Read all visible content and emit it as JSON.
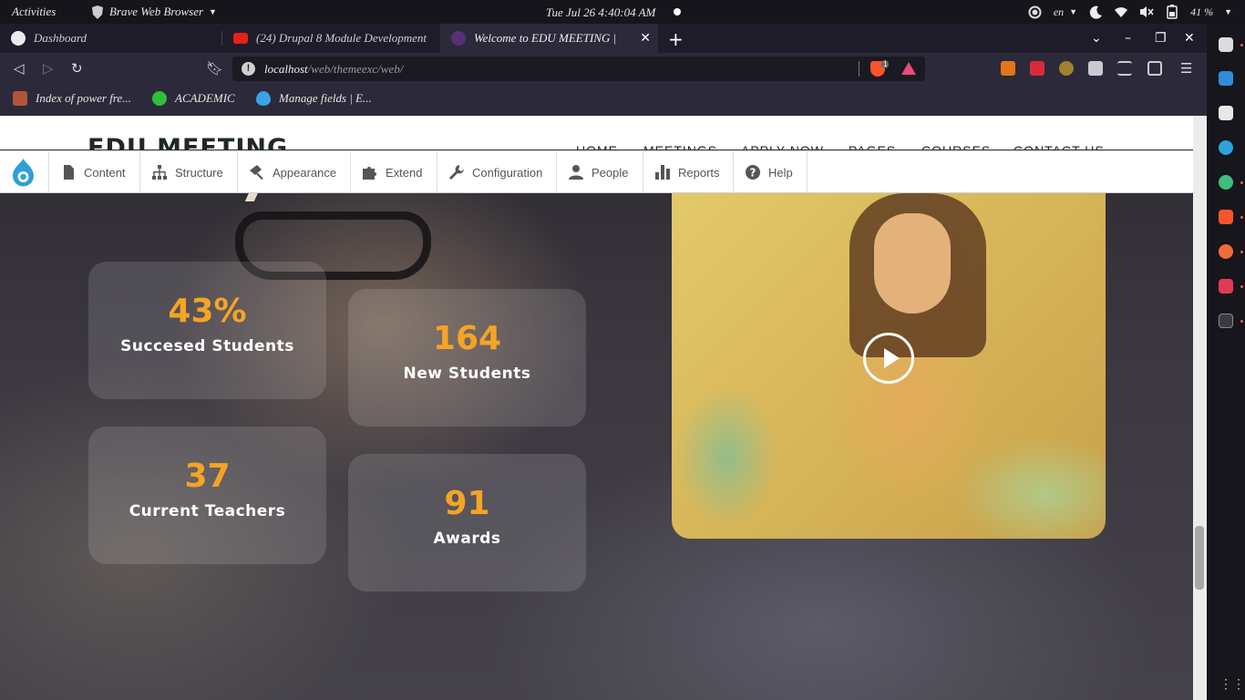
{
  "system_bar": {
    "activities": "Activities",
    "app_name": "Brave Web Browser",
    "clock": "Tue Jul 26  4:40:04 AM",
    "language": "en",
    "battery": "41 %"
  },
  "browser": {
    "tabs": [
      {
        "label": "Dashboard",
        "active": false
      },
      {
        "label": "(24) Drupal 8 Module Development",
        "active": false
      },
      {
        "label": "Welcome to EDU MEETING | ",
        "active": true
      }
    ],
    "url_host": "localhost",
    "url_path": "/web/themeexc/web/",
    "shields_count": "1",
    "bookmarks": [
      {
        "label": "Index of power fre..."
      },
      {
        "label": "ACADEMIC"
      },
      {
        "label": "Manage fields | E..."
      }
    ]
  },
  "site": {
    "logo": "EDU MEETING",
    "nav": [
      "HOME",
      "MEETINGS",
      "APPLY NOW",
      "PAGES",
      "COURSES",
      "CONTACT US"
    ]
  },
  "admin_toolbar": {
    "items": [
      {
        "label": "Content",
        "icon": "file-icon"
      },
      {
        "label": "Structure",
        "icon": "sitemap-icon"
      },
      {
        "label": "Appearance",
        "icon": "brush-icon"
      },
      {
        "label": "Extend",
        "icon": "puzzle-icon"
      },
      {
        "label": "Configuration",
        "icon": "wrench-icon"
      },
      {
        "label": "People",
        "icon": "person-icon"
      },
      {
        "label": "Reports",
        "icon": "bar-chart-icon"
      },
      {
        "label": "Help",
        "icon": "help-icon"
      }
    ]
  },
  "stats": [
    {
      "value": "43%",
      "label": "Succesed Students"
    },
    {
      "value": "164",
      "label": "New Students"
    },
    {
      "value": "37",
      "label": "Current Teachers"
    },
    {
      "value": "91",
      "label": "Awards"
    }
  ],
  "colors": {
    "accent": "#f5a425",
    "drupal_blue": "#2d9fd9"
  }
}
